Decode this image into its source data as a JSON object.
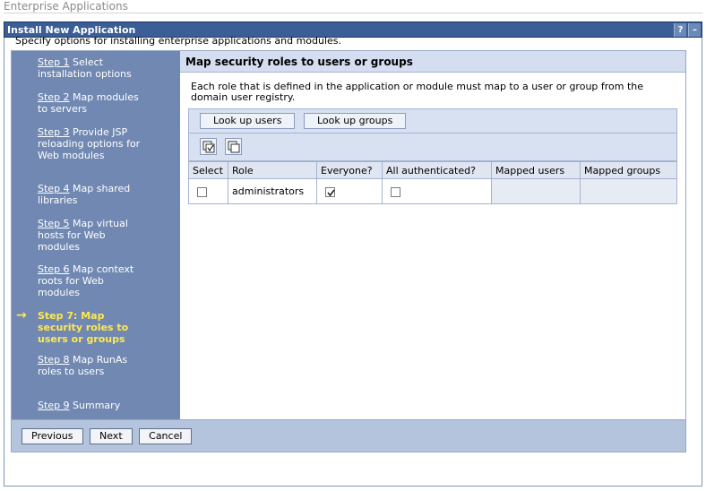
{
  "page": {
    "header": "Enterprise Applications"
  },
  "portlet": {
    "title": "Install New Application",
    "help_icon": "?",
    "minimize_icon": "–"
  },
  "intro": "Specify options for installing enterprise applications and modules.",
  "steps": [
    {
      "link": "Step 1",
      "text": " Select installation options"
    },
    {
      "link": "Step 2",
      "text": " Map modules to servers"
    },
    {
      "link": "Step 3",
      "text": " Provide JSP reloading options for Web modules"
    },
    {
      "link": "Step 4",
      "text": " Map shared libraries"
    },
    {
      "link": "Step 5",
      "text": " Map virtual hosts for Web modules"
    },
    {
      "link": "Step 6",
      "text": " Map context roots for Web modules"
    },
    {
      "current": "Step 7: Map security roles to users or groups"
    },
    {
      "link": "Step 8",
      "text": " Map RunAs roles to users"
    },
    {
      "link": "Step 9",
      "text": " Summary"
    }
  ],
  "current_arrow": "→",
  "content": {
    "title": "Map security roles to users or groups",
    "description": "Each role that is defined in the application or module must map to a user or group from the domain user registry.",
    "buttons": {
      "lookup_users": "Look up users",
      "lookup_groups": "Look up groups"
    },
    "icons": [
      "select-all-icon",
      "deselect-all-icon"
    ],
    "table": {
      "headers": [
        "Select",
        "Role",
        "Everyone?",
        "All authenticated?",
        "Mapped users",
        "Mapped groups"
      ],
      "rows": [
        {
          "select": false,
          "role": "administrators",
          "everyone": true,
          "all_authenticated": false,
          "mapped_users": "",
          "mapped_groups": ""
        }
      ]
    }
  },
  "footer": {
    "previous": "Previous",
    "next": "Next",
    "cancel": "Cancel"
  },
  "colors": {
    "title_bar": "#3a5e95",
    "steps_bg": "#7189b2",
    "current_step": "#ffe84d",
    "header_band": "#d4def0"
  }
}
